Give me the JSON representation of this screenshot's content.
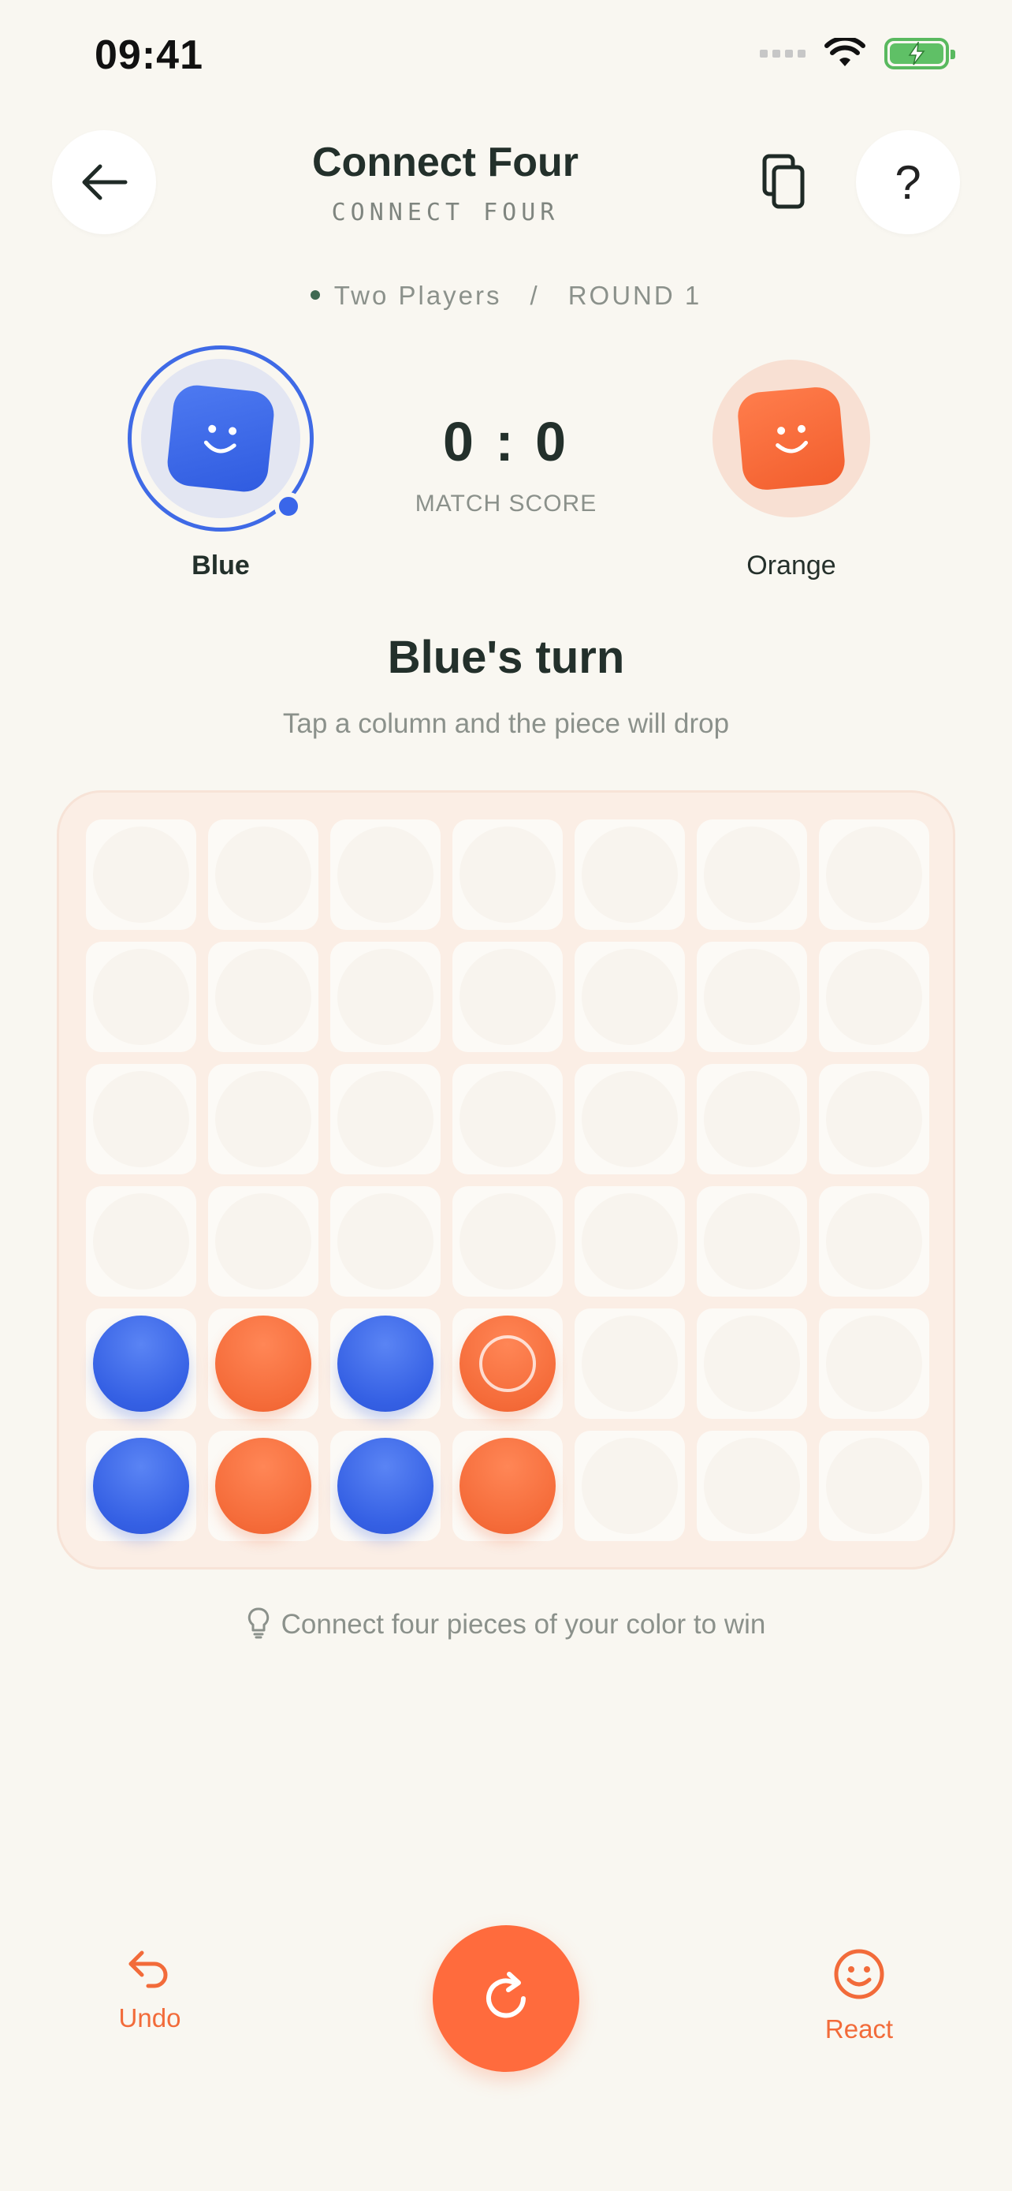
{
  "status_bar": {
    "time": "09:41"
  },
  "header": {
    "title": "Connect Four",
    "subtitle": "CONNECT FOUR",
    "back_icon": "arrow-left-icon",
    "copy_icon": "copy-icon",
    "help_label": "?"
  },
  "mode": {
    "players": "Two Players",
    "separator": "/",
    "round": "ROUND 1"
  },
  "players": {
    "blue": {
      "name": "Blue",
      "color": "#3a66e9",
      "active": true
    },
    "orange": {
      "name": "Orange",
      "color": "#f56c3a",
      "active": false
    }
  },
  "score": {
    "value": "0 : 0",
    "label": "MATCH SCORE"
  },
  "turn": {
    "title": "Blue's turn",
    "subtitle": "Tap a column and the piece will drop"
  },
  "board": {
    "columns": 7,
    "rows": 6,
    "cells": [
      [
        "",
        "",
        "",
        "",
        "",
        "",
        ""
      ],
      [
        "",
        "",
        "",
        "",
        "",
        "",
        ""
      ],
      [
        "",
        "",
        "",
        "",
        "",
        "",
        ""
      ],
      [
        "",
        "",
        "",
        "",
        "",
        "",
        ""
      ],
      [
        "B",
        "O",
        "B",
        "O",
        "",
        "",
        ""
      ],
      [
        "B",
        "O",
        "B",
        "O",
        "",
        "",
        ""
      ]
    ],
    "last_move": {
      "row": 4,
      "col": 3
    }
  },
  "hint": {
    "icon": "lightbulb-icon",
    "text": "Connect four pieces of your color to win"
  },
  "bottom_bar": {
    "undo_label": "Undo",
    "react_label": "React",
    "restart_icon": "restart-icon"
  },
  "colors": {
    "accent": "#ff6b3d",
    "blue": "#3a66e9",
    "background": "#f9f7f1"
  }
}
